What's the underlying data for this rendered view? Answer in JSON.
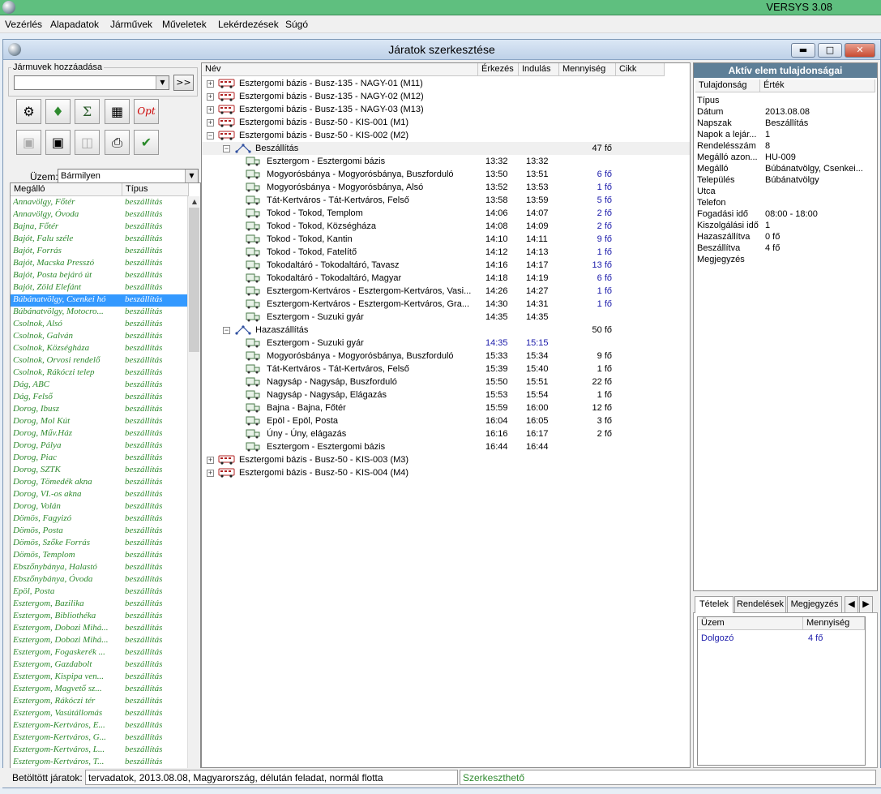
{
  "app": {
    "title": "VERSYS 3.08"
  },
  "menu": [
    "Vezérlés",
    "Alapadatok",
    "Járművek",
    "Műveletek",
    "Lekérdezések",
    "Súgó"
  ],
  "window": {
    "title": "Járatok szerkesztése"
  },
  "left": {
    "group_label": "Jármuvek hozzáadása",
    "add_label": ">>",
    "uzem_label": "Üzem:",
    "uzem_value": "Bármilyen",
    "list_headers": [
      "Megálló",
      "Típus"
    ],
    "stops": [
      [
        "Annavölgy, Főtér",
        "beszállítás"
      ],
      [
        "Annavölgy, Óvoda",
        "beszállítás"
      ],
      [
        "Bajna, Főtér",
        "beszállítás"
      ],
      [
        "Bajót, Falu széle",
        "beszállítás"
      ],
      [
        "Bajót, Forrás",
        "beszállítás"
      ],
      [
        "Bajót, Macska Presszó",
        "beszállítás"
      ],
      [
        "Bajót, Posta bejáró út",
        "beszállítás"
      ],
      [
        "Bajót, Zöld Elefánt",
        "beszállítás"
      ],
      [
        "Búbánatvölgy, Csenkei hó",
        "beszállítás"
      ],
      [
        "Búbánatvölgy, Motocro...",
        "beszállítás"
      ],
      [
        "Csolnok, Alsó",
        "beszállítás"
      ],
      [
        "Csolnok, Galván",
        "beszállítás"
      ],
      [
        "Csolnok, Községháza",
        "beszállítás"
      ],
      [
        "Csolnok, Orvosi rendelő",
        "beszállítás"
      ],
      [
        "Csolnok, Rákóczi telep",
        "beszállítás"
      ],
      [
        "Dág, ABC",
        "beszállítás"
      ],
      [
        "Dág, Felső",
        "beszállítás"
      ],
      [
        "Dorog, Ibusz",
        "beszállítás"
      ],
      [
        "Dorog, Mol Kút",
        "beszállítás"
      ],
      [
        "Dorog, Műv.Ház",
        "beszállítás"
      ],
      [
        "Dorog, Pálya",
        "beszállítás"
      ],
      [
        "Dorog, Piac",
        "beszállítás"
      ],
      [
        "Dorog, SZTK",
        "beszállítás"
      ],
      [
        "Dorog, Tömedék akna",
        "beszállítás"
      ],
      [
        "Dorog, VI.-os akna",
        "beszállítás"
      ],
      [
        "Dorog, Volán",
        "beszállítás"
      ],
      [
        "Dömös, Fagyizó",
        "beszállítás"
      ],
      [
        "Dömös, Posta",
        "beszállítás"
      ],
      [
        "Dömös, Szőke Forrás",
        "beszállítás"
      ],
      [
        "Dömös, Templom",
        "beszállítás"
      ],
      [
        "Ebszőnybánya, Halastó",
        "beszállítás"
      ],
      [
        "Ebszőnybánya, Óvoda",
        "beszállítás"
      ],
      [
        "Epöl, Posta",
        "beszállítás"
      ],
      [
        "Esztergom, Bazilika",
        "beszállítás"
      ],
      [
        "Esztergom, Bibliothéka",
        "beszállítás"
      ],
      [
        "Esztergom, Dobozi Mihá...",
        "beszállítás"
      ],
      [
        "Esztergom, Dobozi Mihá...",
        "beszállítás"
      ],
      [
        "Esztergom, Fogaskerék ...",
        "beszállítás"
      ],
      [
        "Esztergom, Gazdabolt",
        "beszállítás"
      ],
      [
        "Esztergom, Kispipa ven...",
        "beszállítás"
      ],
      [
        "Esztergom, Magvető sz...",
        "beszállítás"
      ],
      [
        "Esztergom, Rákóczi tér",
        "beszállítás"
      ],
      [
        "Esztergom, Vasútállomás",
        "beszállítás"
      ],
      [
        "Esztergom-Kertváros, E...",
        "beszállítás"
      ],
      [
        "Esztergom-Kertváros, G...",
        "beszállítás"
      ],
      [
        "Esztergom-Kertváros, L...",
        "beszállítás"
      ],
      [
        "Esztergom-Kertváros, T...",
        "beszállítás"
      ]
    ]
  },
  "tree": {
    "headers": [
      "Név",
      "Érkezés",
      "Indulás",
      "Mennyiség",
      "Cikk"
    ],
    "rows": [
      {
        "lvl": 0,
        "exp": "+",
        "icon": "bus",
        "name": "Esztergomi bázis - Busz-135 - NAGY-01 (M11)",
        "arr": "",
        "dep": "",
        "qty": "",
        "blue": false,
        "hl": false
      },
      {
        "lvl": 0,
        "exp": "+",
        "icon": "bus",
        "name": "Esztergomi bázis - Busz-135 - NAGY-02 (M12)",
        "arr": "",
        "dep": "",
        "qty": "",
        "blue": false,
        "hl": false
      },
      {
        "lvl": 0,
        "exp": "+",
        "icon": "bus",
        "name": "Esztergomi bázis - Busz-135 - NAGY-03 (M13)",
        "arr": "",
        "dep": "",
        "qty": "",
        "blue": false,
        "hl": false
      },
      {
        "lvl": 0,
        "exp": "+",
        "icon": "bus",
        "name": "Esztergomi bázis - Busz-50 - KIS-001 (M1)",
        "arr": "",
        "dep": "",
        "qty": "",
        "blue": false,
        "hl": false
      },
      {
        "lvl": 0,
        "exp": "−",
        "icon": "bus",
        "name": "Esztergomi bázis - Busz-50 - KIS-002 (M2)",
        "arr": "",
        "dep": "",
        "qty": "",
        "blue": false,
        "hl": false
      },
      {
        "lvl": 1,
        "exp": "−",
        "icon": "route",
        "name": "Beszállítás",
        "arr": "",
        "dep": "",
        "qty": "47 fő",
        "blue": false,
        "hl": true
      },
      {
        "lvl": 2,
        "exp": "",
        "icon": "stop",
        "name": "Esztergom - Esztergomi bázis",
        "arr": "13:32",
        "dep": "13:32",
        "qty": "",
        "blue": false,
        "hl": false
      },
      {
        "lvl": 2,
        "exp": "",
        "icon": "stop",
        "name": "Mogyorósbánya - Mogyorósbánya, Buszforduló",
        "arr": "13:50",
        "dep": "13:51",
        "qty": "6 fő",
        "blue": true,
        "hl": false
      },
      {
        "lvl": 2,
        "exp": "",
        "icon": "stop",
        "name": "Mogyorósbánya - Mogyorósbánya, Alsó",
        "arr": "13:52",
        "dep": "13:53",
        "qty": "1 fő",
        "blue": true,
        "hl": false
      },
      {
        "lvl": 2,
        "exp": "",
        "icon": "stop",
        "name": "Tát-Kertváros - Tát-Kertváros, Felső",
        "arr": "13:58",
        "dep": "13:59",
        "qty": "5 fő",
        "blue": true,
        "hl": false
      },
      {
        "lvl": 2,
        "exp": "",
        "icon": "stop",
        "name": "Tokod - Tokod, Templom",
        "arr": "14:06",
        "dep": "14:07",
        "qty": "2 fő",
        "blue": true,
        "hl": false
      },
      {
        "lvl": 2,
        "exp": "",
        "icon": "stop",
        "name": "Tokod - Tokod, Községháza",
        "arr": "14:08",
        "dep": "14:09",
        "qty": "2 fő",
        "blue": true,
        "hl": false
      },
      {
        "lvl": 2,
        "exp": "",
        "icon": "stop",
        "name": "Tokod - Tokod, Kantin",
        "arr": "14:10",
        "dep": "14:11",
        "qty": "9 fő",
        "blue": true,
        "hl": false
      },
      {
        "lvl": 2,
        "exp": "",
        "icon": "stop",
        "name": "Tokod - Tokod, Fatelítő",
        "arr": "14:12",
        "dep": "14:13",
        "qty": "1 fő",
        "blue": true,
        "hl": false
      },
      {
        "lvl": 2,
        "exp": "",
        "icon": "stop",
        "name": "Tokodaltáró - Tokodaltáró, Tavasz",
        "arr": "14:16",
        "dep": "14:17",
        "qty": "13 fő",
        "blue": true,
        "hl": false
      },
      {
        "lvl": 2,
        "exp": "",
        "icon": "stop",
        "name": "Tokodaltáró - Tokodaltáró, Magyar",
        "arr": "14:18",
        "dep": "14:19",
        "qty": "6 fő",
        "blue": true,
        "hl": false
      },
      {
        "lvl": 2,
        "exp": "",
        "icon": "stop",
        "name": "Esztergom-Kertváros - Esztergom-Kertváros, Vasi...",
        "arr": "14:26",
        "dep": "14:27",
        "qty": "1 fő",
        "blue": true,
        "hl": false
      },
      {
        "lvl": 2,
        "exp": "",
        "icon": "stop",
        "name": "Esztergom-Kertváros - Esztergom-Kertváros, Gra...",
        "arr": "14:30",
        "dep": "14:31",
        "qty": "1 fő",
        "blue": true,
        "hl": false
      },
      {
        "lvl": 2,
        "exp": "",
        "icon": "stop",
        "name": "Esztergom - Suzuki gyár",
        "arr": "14:35",
        "dep": "14:35",
        "qty": "",
        "blue": false,
        "hl": false
      },
      {
        "lvl": 1,
        "exp": "−",
        "icon": "route",
        "name": "Hazaszállítás",
        "arr": "",
        "dep": "",
        "qty": "50 fő",
        "blue": false,
        "hl": false
      },
      {
        "lvl": 2,
        "exp": "",
        "icon": "stop",
        "name": "Esztergom - Suzuki gyár",
        "arr": "14:35",
        "dep": "15:15",
        "qty": "",
        "blue": false,
        "hl": false,
        "timeblue": true
      },
      {
        "lvl": 2,
        "exp": "",
        "icon": "stop",
        "name": "Mogyorósbánya - Mogyorósbánya, Buszforduló",
        "arr": "15:33",
        "dep": "15:34",
        "qty": "9 fő",
        "blue": false,
        "hl": false
      },
      {
        "lvl": 2,
        "exp": "",
        "icon": "stop",
        "name": "Tát-Kertváros - Tát-Kertváros, Felső",
        "arr": "15:39",
        "dep": "15:40",
        "qty": "1 fő",
        "blue": false,
        "hl": false
      },
      {
        "lvl": 2,
        "exp": "",
        "icon": "stop",
        "name": "Nagysáp - Nagysáp, Buszforduló",
        "arr": "15:50",
        "dep": "15:51",
        "qty": "22 fő",
        "blue": false,
        "hl": false
      },
      {
        "lvl": 2,
        "exp": "",
        "icon": "stop",
        "name": "Nagysáp - Nagysáp, Elágazás",
        "arr": "15:53",
        "dep": "15:54",
        "qty": "1 fő",
        "blue": false,
        "hl": false
      },
      {
        "lvl": 2,
        "exp": "",
        "icon": "stop",
        "name": "Bajna - Bajna, Főtér",
        "arr": "15:59",
        "dep": "16:00",
        "qty": "12 fő",
        "blue": false,
        "hl": false
      },
      {
        "lvl": 2,
        "exp": "",
        "icon": "stop",
        "name": "Epöl - Epöl, Posta",
        "arr": "16:04",
        "dep": "16:05",
        "qty": "3 fő",
        "blue": false,
        "hl": false
      },
      {
        "lvl": 2,
        "exp": "",
        "icon": "stop",
        "name": "Úny - Úny, elágazás",
        "arr": "16:16",
        "dep": "16:17",
        "qty": "2 fő",
        "blue": false,
        "hl": false
      },
      {
        "lvl": 2,
        "exp": "",
        "icon": "stop",
        "name": "Esztergom - Esztergomi bázis",
        "arr": "16:44",
        "dep": "16:44",
        "qty": "",
        "blue": false,
        "hl": false
      },
      {
        "lvl": 0,
        "exp": "+",
        "icon": "bus",
        "name": "Esztergomi bázis - Busz-50 - KIS-003 (M3)",
        "arr": "",
        "dep": "",
        "qty": "",
        "blue": false,
        "hl": false
      },
      {
        "lvl": 0,
        "exp": "+",
        "icon": "bus",
        "name": "Esztergomi bázis - Busz-50 - KIS-004 (M4)",
        "arr": "",
        "dep": "",
        "qty": "",
        "blue": false,
        "hl": false
      }
    ]
  },
  "props": {
    "title": "Aktív elem tulajdonságai",
    "headers": [
      "Tulajdonság",
      "Érték"
    ],
    "rows": [
      [
        "Típus",
        ""
      ],
      [
        "Dátum",
        "2013.08.08"
      ],
      [
        "Napszak",
        "Beszállítás"
      ],
      [
        "Napok a lejár...",
        "1"
      ],
      [
        "Rendelésszám",
        "8"
      ],
      [
        "Megálló azon...",
        "HU-009"
      ],
      [
        "Megálló",
        "Búbánatvölgy, Csenkei..."
      ],
      [
        "Település",
        "Búbánatvölgy"
      ],
      [
        "Utca",
        ""
      ],
      [
        "Telefon",
        ""
      ],
      [
        "Fogadási idő",
        "08:00 - 18:00"
      ],
      [
        "Kiszolgálási idő",
        "1"
      ],
      [
        "Hazaszállítva",
        "0 fő"
      ],
      [
        "Beszállítva",
        "4 fő"
      ],
      [
        "Megjegyzés",
        ""
      ]
    ]
  },
  "tabs": {
    "labels": [
      "Tételek",
      "Rendelések",
      "Megjegyzés"
    ],
    "headers": [
      "Üzem",
      "Mennyiség"
    ],
    "rows": [
      [
        "Dolgozó",
        "4 fő"
      ]
    ]
  },
  "status": {
    "label": "Betöltött járatok:",
    "value": "tervadatok, 2013.08.08, Magyarország, délután feladat, normál flotta",
    "mode": "Szerkeszthető"
  },
  "colors": {
    "titlebar": "#5fbf7f",
    "stop_text": "#2f8a2f",
    "selection": "#3399ff",
    "props_header": "#5e7f97",
    "qty_blue": "#1a1aaa"
  }
}
